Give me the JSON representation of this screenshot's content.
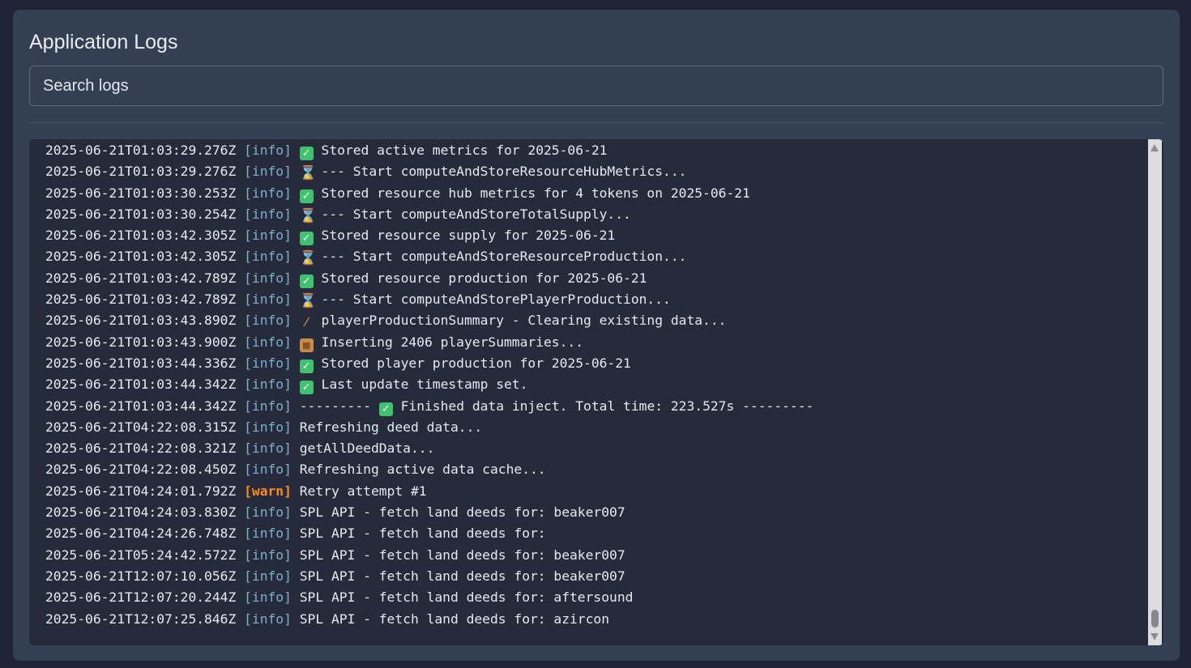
{
  "header": {
    "title": "Application Logs"
  },
  "search": {
    "placeholder": "Search logs",
    "value": ""
  },
  "colors": {
    "info": "#7eb0c9",
    "warn": "#ff8c1a",
    "check_icon": "#3ec26d"
  },
  "logs": [
    {
      "ts": "2025-06-21T01:03:29.276Z",
      "level": "info",
      "icon": "check-icon",
      "msg": "Stored active metrics for 2025-06-21"
    },
    {
      "ts": "2025-06-21T01:03:29.276Z",
      "level": "info",
      "icon": "hourglass-icon",
      "msg": "--- Start computeAndStoreResourceHubMetrics..."
    },
    {
      "ts": "2025-06-21T01:03:30.253Z",
      "level": "info",
      "icon": "check-icon",
      "msg": "Stored resource hub metrics for 4 tokens on 2025-06-21"
    },
    {
      "ts": "2025-06-21T01:03:30.254Z",
      "level": "info",
      "icon": "hourglass-icon",
      "msg": "--- Start computeAndStoreTotalSupply..."
    },
    {
      "ts": "2025-06-21T01:03:42.305Z",
      "level": "info",
      "icon": "check-icon",
      "msg": "Stored resource supply for 2025-06-21"
    },
    {
      "ts": "2025-06-21T01:03:42.305Z",
      "level": "info",
      "icon": "hourglass-icon",
      "msg": "--- Start computeAndStoreResourceProduction..."
    },
    {
      "ts": "2025-06-21T01:03:42.789Z",
      "level": "info",
      "icon": "check-icon",
      "msg": "Stored resource production for 2025-06-21"
    },
    {
      "ts": "2025-06-21T01:03:42.789Z",
      "level": "info",
      "icon": "hourglass-icon",
      "msg": "--- Start computeAndStorePlayerProduction..."
    },
    {
      "ts": "2025-06-21T01:03:43.890Z",
      "level": "info",
      "icon": "broom-icon",
      "msg": "playerProductionSummary - Clearing existing data..."
    },
    {
      "ts": "2025-06-21T01:03:43.900Z",
      "level": "info",
      "icon": "package-icon",
      "msg": "Inserting 2406 playerSummaries..."
    },
    {
      "ts": "2025-06-21T01:03:44.336Z",
      "level": "info",
      "icon": "check-icon",
      "msg": "Stored player production for 2025-06-21"
    },
    {
      "ts": "2025-06-21T01:03:44.342Z",
      "level": "info",
      "icon": "check-icon",
      "msg": "Last update timestamp set."
    },
    {
      "ts": "2025-06-21T01:03:44.342Z",
      "level": "info",
      "prefix": "---------",
      "icon": "check-icon",
      "msg": "Finished data inject. Total time: 223.527s ---------"
    },
    {
      "ts": "2025-06-21T04:22:08.315Z",
      "level": "info",
      "msg": "Refreshing deed data..."
    },
    {
      "ts": "2025-06-21T04:22:08.321Z",
      "level": "info",
      "msg": "getAllDeedData..."
    },
    {
      "ts": "2025-06-21T04:22:08.450Z",
      "level": "info",
      "msg": "Refreshing active data cache..."
    },
    {
      "ts": "2025-06-21T04:24:01.792Z",
      "level": "warn",
      "msg": "Retry attempt #1"
    },
    {
      "ts": "2025-06-21T04:24:03.830Z",
      "level": "info",
      "msg": "SPL API - fetch land deeds for: beaker007"
    },
    {
      "ts": "2025-06-21T04:24:26.748Z",
      "level": "info",
      "msg": "SPL API - fetch land deeds for:"
    },
    {
      "ts": "2025-06-21T05:24:42.572Z",
      "level": "info",
      "msg": "SPL API - fetch land deeds for: beaker007"
    },
    {
      "ts": "2025-06-21T12:07:10.056Z",
      "level": "info",
      "msg": "SPL API - fetch land deeds for: beaker007"
    },
    {
      "ts": "2025-06-21T12:07:20.244Z",
      "level": "info",
      "msg": "SPL API - fetch land deeds for: aftersound"
    },
    {
      "ts": "2025-06-21T12:07:25.846Z",
      "level": "info",
      "msg": "SPL API - fetch land deeds for: azircon"
    }
  ]
}
